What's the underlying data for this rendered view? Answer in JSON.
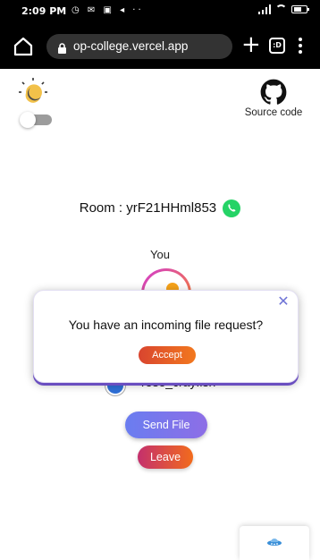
{
  "status_bar": {
    "time": "2:09 PM",
    "left_icons": "◷ ✉ ▣ ◂ ··"
  },
  "browser": {
    "url": "op-college.vercel.app",
    "tabs_count": ":D"
  },
  "header": {
    "source_label": "Source code"
  },
  "room": {
    "label": "Room : yrF21HHml853"
  },
  "self": {
    "label": "You"
  },
  "peer": {
    "name": "rose_crayfish"
  },
  "actions": {
    "send_label": "Send File",
    "leave_label": "Leave"
  },
  "modal": {
    "message": "You have an incoming file request?",
    "accept_label": "Accept",
    "close_symbol": "✕"
  },
  "colors": {
    "send": "#7a76ec",
    "leave": "#e0503a",
    "accent": "#6a4ec0",
    "whatsapp": "#25d366"
  }
}
